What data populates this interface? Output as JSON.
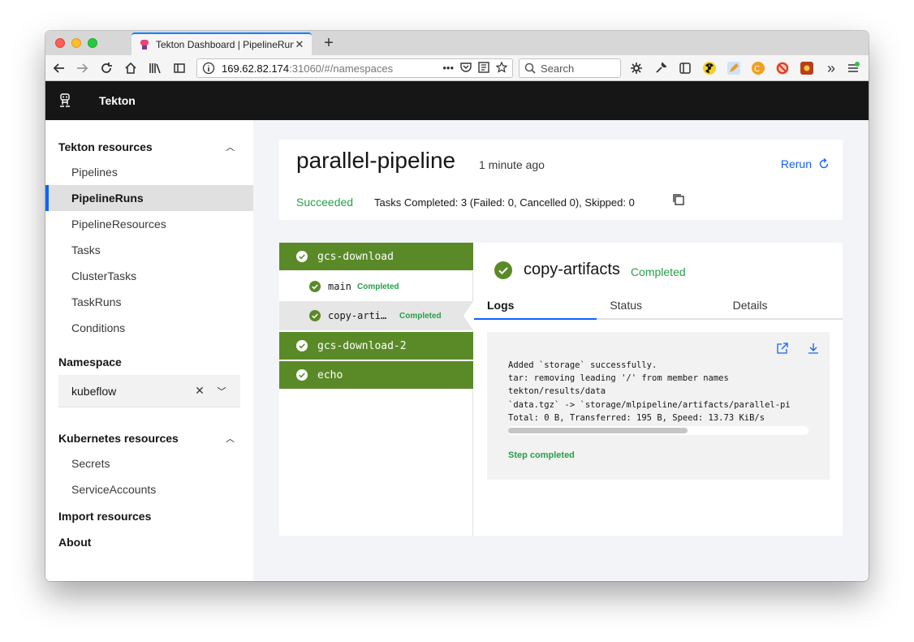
{
  "browser": {
    "tab_title": "Tekton Dashboard | PipelineRun",
    "tab_close": "✕",
    "new_tab": "+",
    "url_host": "169.62.82.174",
    "url_rest": ":31060/#/namespaces",
    "url_more": "•••",
    "search_placeholder": "Search",
    "overflow": "»"
  },
  "app": {
    "name": "Tekton"
  },
  "sidebar": {
    "tekton_section": "Tekton resources",
    "items": [
      {
        "label": "Pipelines"
      },
      {
        "label": "PipelineRuns"
      },
      {
        "label": "PipelineResources"
      },
      {
        "label": "Tasks"
      },
      {
        "label": "ClusterTasks"
      },
      {
        "label": "TaskRuns"
      },
      {
        "label": "Conditions"
      }
    ],
    "namespace_label": "Namespace",
    "namespace_value": "kubeflow",
    "namespace_clear": "✕",
    "k8s_section": "Kubernetes resources",
    "k8s_items": [
      {
        "label": "Secrets"
      },
      {
        "label": "ServiceAccounts"
      }
    ],
    "import_label": "Import resources",
    "about_label": "About",
    "chevron_up": "︿",
    "chevron_down": "﹀"
  },
  "run": {
    "title": "parallel-pipeline",
    "time": "1 minute ago",
    "rerun": "Rerun",
    "status": "Succeeded",
    "summary": "Tasks Completed: 3 (Failed: 0, Cancelled 0), Skipped: 0"
  },
  "tasks": [
    {
      "name": "gcs-download"
    },
    {
      "name": "gcs-download-2"
    },
    {
      "name": "echo"
    }
  ],
  "steps": [
    {
      "name": "main",
      "status": "Completed"
    },
    {
      "name": "copy-artifacts",
      "status": "Completed"
    }
  ],
  "detail": {
    "title": "copy-artifacts",
    "status": "Completed",
    "tabs": [
      "Logs",
      "Status",
      "Details"
    ],
    "log_lines": "Added `storage` successfully.\ntar: removing leading '/' from member names\ntekton/results/data\n`data.tgz` -> `storage/mlpipeline/artifacts/parallel-pi\nTotal: 0 B, Transferred: 195 B, Speed: 13.73 KiB/s",
    "step_done": "Step completed"
  },
  "colors": {
    "accent": "#0f62fe",
    "success": "#24a148",
    "task_bg": "#5a8a28",
    "header_bg": "#161616"
  }
}
